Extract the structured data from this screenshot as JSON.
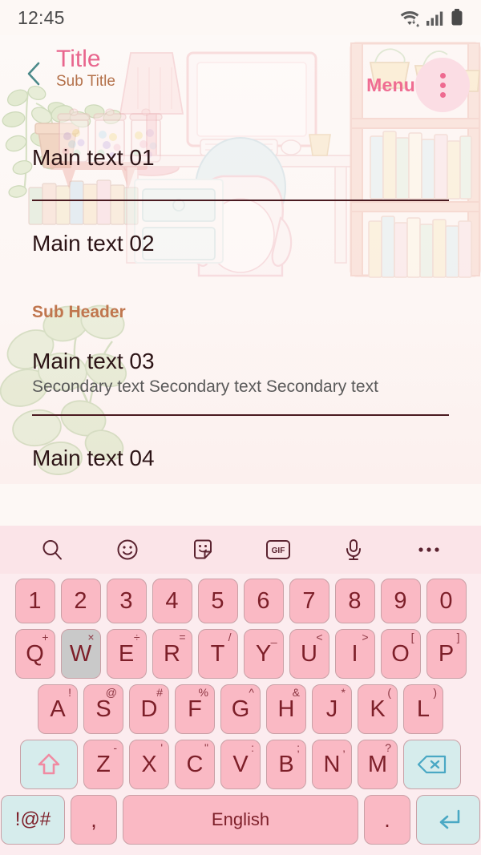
{
  "status_bar": {
    "time": "12:45",
    "icons": [
      "wifi-icon",
      "cellular-signal-icon",
      "battery-icon"
    ]
  },
  "app_bar": {
    "back_icon": "chevron-left-icon",
    "title": "Title",
    "subtitle": "Sub Title",
    "menu_label": "Menu",
    "overflow_icon": "more-vertical-icon",
    "colors": {
      "title": "#e8658d",
      "subtitle": "#b4714a",
      "menu": "#ef6d92",
      "back_chevron": "#4c8a8a",
      "overflow_circle": "#fbdde4"
    }
  },
  "content": {
    "rows": [
      {
        "main": "Main text 01",
        "secondary": ""
      },
      {
        "main": "Main text 02",
        "secondary": ""
      },
      {
        "main": "Main text 03",
        "secondary": "Secondary text Secondary text Secondary text"
      },
      {
        "main": "Main text 04",
        "secondary": ""
      }
    ],
    "sub_header": "Sub Header",
    "colors": {
      "main_text": "#2c1416",
      "secondary_text": "#5a5a5a",
      "sub_header": "#c0764e",
      "divider": "#4a1a20"
    }
  },
  "keyboard": {
    "toolbar": [
      {
        "name": "search-icon",
        "label": ""
      },
      {
        "name": "emoji-icon",
        "label": ""
      },
      {
        "name": "sticker-icon",
        "label": ""
      },
      {
        "name": "gif-icon",
        "label": "GIF"
      },
      {
        "name": "microphone-icon",
        "label": ""
      },
      {
        "name": "more-horizontal-icon",
        "label": ""
      }
    ],
    "row_numbers": [
      {
        "key": "1"
      },
      {
        "key": "2"
      },
      {
        "key": "3"
      },
      {
        "key": "4"
      },
      {
        "key": "5"
      },
      {
        "key": "6"
      },
      {
        "key": "7"
      },
      {
        "key": "8"
      },
      {
        "key": "9"
      },
      {
        "key": "0"
      }
    ],
    "row_top": [
      {
        "key": "Q",
        "sup": "+",
        "pressed": false
      },
      {
        "key": "W",
        "sup": "×",
        "pressed": true
      },
      {
        "key": "E",
        "sup": "÷",
        "pressed": false
      },
      {
        "key": "R",
        "sup": "=",
        "pressed": false
      },
      {
        "key": "T",
        "sup": "/",
        "pressed": false
      },
      {
        "key": "Y",
        "sup": "_",
        "pressed": false
      },
      {
        "key": "U",
        "sup": "<",
        "pressed": false
      },
      {
        "key": "I",
        "sup": ">",
        "pressed": false
      },
      {
        "key": "O",
        "sup": "[",
        "pressed": false
      },
      {
        "key": "P",
        "sup": "]",
        "pressed": false
      }
    ],
    "row_home": [
      {
        "key": "A",
        "sup": "!"
      },
      {
        "key": "S",
        "sup": "@"
      },
      {
        "key": "D",
        "sup": "#"
      },
      {
        "key": "F",
        "sup": "%"
      },
      {
        "key": "G",
        "sup": "^"
      },
      {
        "key": "H",
        "sup": "&"
      },
      {
        "key": "J",
        "sup": "*"
      },
      {
        "key": "K",
        "sup": "("
      },
      {
        "key": "L",
        "sup": ")"
      }
    ],
    "row_bottom": [
      {
        "key": "Z",
        "sup": "-"
      },
      {
        "key": "X",
        "sup": "'"
      },
      {
        "key": "C",
        "sup": "\""
      },
      {
        "key": "V",
        "sup": ":"
      },
      {
        "key": "B",
        "sup": ";"
      },
      {
        "key": "N",
        "sup": ","
      },
      {
        "key": "M",
        "sup": "?"
      }
    ],
    "shift_icon": "shift-arrow-icon",
    "backspace_icon": "backspace-icon",
    "symbols_label": "!@#",
    "comma_label": ",",
    "space_label": "English",
    "period_label": ".",
    "enter_icon": "enter-return-icon",
    "colors": {
      "key_bg": "#fab9c4",
      "key_border": "#c9a0a6",
      "key_text": "#7d1f29",
      "function_key_bg": "#d6ecec",
      "pressed_key_bg": "#c9c9c9",
      "toolbar_bg": "#fbe4e8",
      "keyboard_bg": "#fcecef"
    }
  }
}
